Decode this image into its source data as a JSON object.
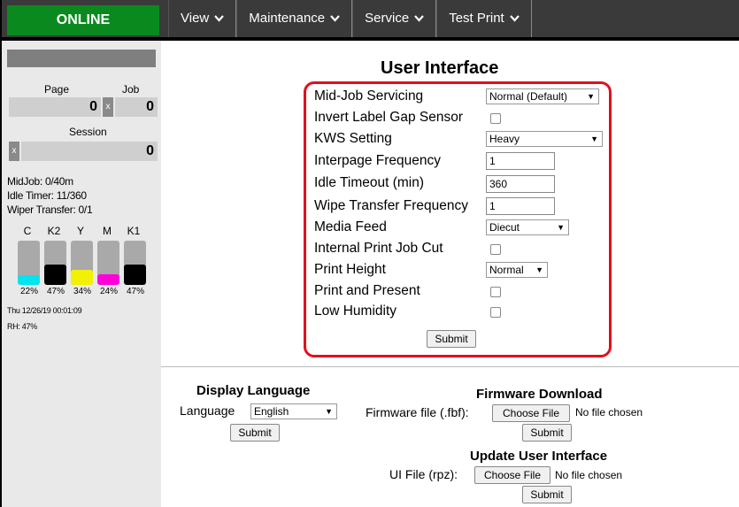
{
  "header": {
    "status": "ONLINE",
    "nav": [
      {
        "label": "View"
      },
      {
        "label": "Maintenance"
      },
      {
        "label": "Service"
      },
      {
        "label": "Test Print"
      }
    ]
  },
  "sidebar": {
    "page_label": "Page",
    "job_label": "Job",
    "page_count": "0",
    "job_count": "0",
    "session_label": "Session",
    "session_count": "0",
    "clear_symbol": "x",
    "midjob": "MidJob: 0/40m",
    "idle_timer": "Idle Timer: 11/360",
    "wiper_transfer": "Wiper Transfer: 0/1",
    "inks": [
      {
        "name": "C",
        "pct_label": "22%",
        "level": 0.22,
        "color": "#00e5f0"
      },
      {
        "name": "K2",
        "pct_label": "47%",
        "level": 0.47,
        "color": "#000000"
      },
      {
        "name": "Y",
        "pct_label": "34%",
        "level": 0.34,
        "color": "#f2f200"
      },
      {
        "name": "M",
        "pct_label": "24%",
        "level": 0.24,
        "color": "#ff00d8"
      },
      {
        "name": "K1",
        "pct_label": "47%",
        "level": 0.47,
        "color": "#000000"
      }
    ],
    "datetime": "Thu 12/26/19 00:01:09",
    "rh": "RH: 47%"
  },
  "main": {
    "title": "User Interface",
    "settings": {
      "mid_job_servicing": {
        "label": "Mid-Job Servicing",
        "value": "Normal (Default)"
      },
      "invert_label_gap": {
        "label": "Invert Label Gap Sensor"
      },
      "kws_setting": {
        "label": "KWS Setting",
        "value": "Heavy"
      },
      "interpage_frequency": {
        "label": "Interpage Frequency",
        "value": "1"
      },
      "idle_timeout": {
        "label": "Idle Timeout (min)",
        "value": "360"
      },
      "wipe_transfer_frequency": {
        "label": "Wipe Transfer Frequency",
        "value": "1"
      },
      "media_feed": {
        "label": "Media Feed",
        "value": "Diecut"
      },
      "internal_print_job_cut": {
        "label": "Internal Print Job Cut"
      },
      "print_height": {
        "label": "Print Height",
        "value": "Normal"
      },
      "print_and_present": {
        "label": "Print and Present"
      },
      "low_humidity": {
        "label": "Low Humidity"
      },
      "submit": "Submit"
    },
    "display_language": {
      "title": "Display Language",
      "label": "Language",
      "value": "English",
      "submit": "Submit"
    },
    "firmware": {
      "title": "Firmware Download",
      "label": "Firmware file (.fbf):",
      "choose": "Choose File",
      "no_file": "No file chosen",
      "submit": "Submit"
    },
    "update_ui": {
      "title": "Update User Interface",
      "label": "UI File (rpz):",
      "choose": "Choose File",
      "no_file": "No file chosen",
      "submit": "Submit"
    }
  }
}
